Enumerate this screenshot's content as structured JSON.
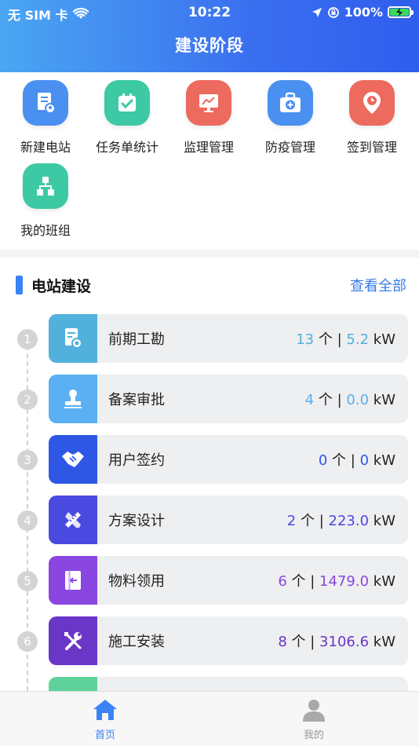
{
  "status_bar": {
    "carrier": "无 SIM 卡",
    "time": "10:22",
    "battery": "100%",
    "battery_level": 1.0
  },
  "header": {
    "title": "建设阶段"
  },
  "quick_menu": [
    {
      "label": "新建电站",
      "icon": "station-doc-icon",
      "color": "#4a90f0"
    },
    {
      "label": "任务单统计",
      "icon": "checklist-icon",
      "color": "#3cc9a4"
    },
    {
      "label": "监理管理",
      "icon": "monitor-chart-icon",
      "color": "#ec6a5e"
    },
    {
      "label": "防疫管理",
      "icon": "medical-kit-icon",
      "color": "#4a90f0"
    },
    {
      "label": "签到管理",
      "icon": "location-pin-icon",
      "color": "#ec6a5e"
    },
    {
      "label": "我的班组",
      "icon": "team-structure-icon",
      "color": "#3cc9a4"
    }
  ],
  "station": {
    "title": "电站建设",
    "view_all": "查看全部",
    "stages": [
      {
        "index": "1",
        "name": "前期工勘",
        "count": "13",
        "unit_count": "个",
        "sep": "|",
        "capacity": "5.2",
        "unit_cap": "kW",
        "color": "#52b0dc",
        "value_color": "#52b0dc",
        "icon": "survey-doc-icon"
      },
      {
        "index": "2",
        "name": "备案审批",
        "count": "4",
        "unit_count": "个",
        "sep": "|",
        "capacity": "0.0",
        "unit_cap": "kW",
        "color": "#5ab0f2",
        "value_color": "#5ab0f2",
        "icon": "stamp-icon"
      },
      {
        "index": "3",
        "name": "用户签约",
        "count": "0",
        "unit_count": "个",
        "sep": "|",
        "capacity": "0",
        "unit_cap": "kW",
        "color": "#2f57e6",
        "value_color": "#2f57e6",
        "icon": "handshake-icon"
      },
      {
        "index": "4",
        "name": "方案设计",
        "count": "2",
        "unit_count": "个",
        "sep": "|",
        "capacity": "223.0",
        "unit_cap": "kW",
        "color": "#4a4ae0",
        "value_color": "#4a4ae0",
        "icon": "ruler-pencil-icon"
      },
      {
        "index": "5",
        "name": "物料领用",
        "count": "6",
        "unit_count": "个",
        "sep": "|",
        "capacity": "1479.0",
        "unit_cap": "kW",
        "color": "#8a46e0",
        "value_color": "#8a46e0",
        "icon": "material-box-icon"
      },
      {
        "index": "6",
        "name": "施工安装",
        "count": "8",
        "unit_count": "个",
        "sep": "|",
        "capacity": "3106.6",
        "unit_cap": "kW",
        "color": "#6a36c8",
        "value_color": "#6a36c8",
        "icon": "tools-icon"
      }
    ]
  },
  "tabbar": {
    "tabs": [
      {
        "label": "首页",
        "icon": "home-icon",
        "active": true,
        "color": "#3b82f6"
      },
      {
        "label": "我的",
        "icon": "user-icon",
        "active": false,
        "color": "#999999"
      }
    ]
  }
}
